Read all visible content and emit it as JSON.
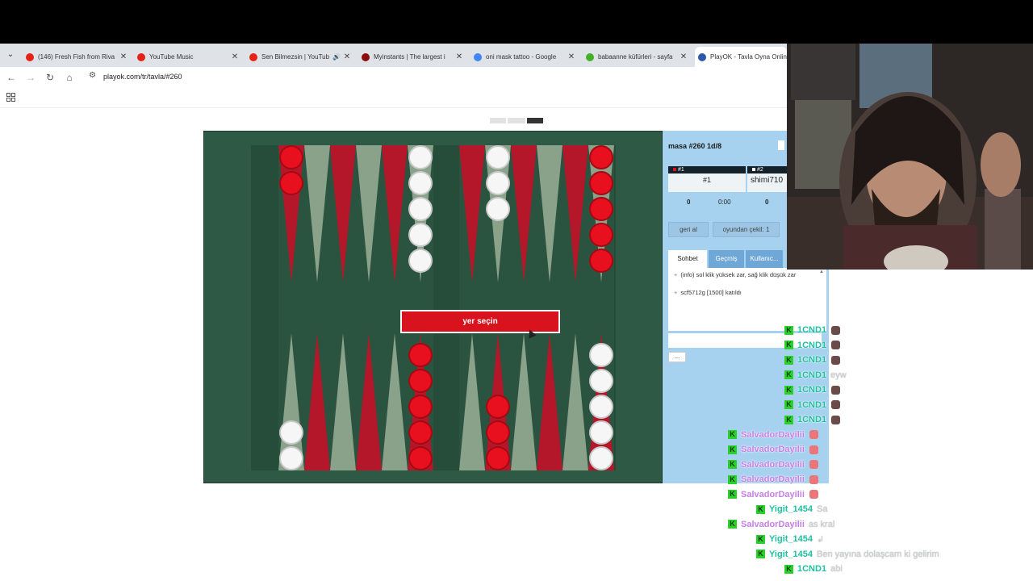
{
  "browser": {
    "tabs": [
      {
        "title": "(146) Fresh Fish from Riva",
        "icon": "youtube-icon",
        "color": "#e62117",
        "active": false
      },
      {
        "title": "YouTube Music",
        "icon": "youtube-music-icon",
        "color": "#e62117",
        "active": false
      },
      {
        "title": "Sen Bilmezsin | YouTub",
        "icon": "youtube-music-icon",
        "color": "#e62117",
        "active": false,
        "audio": "🔊"
      },
      {
        "title": "Myinstants | The largest i",
        "icon": "myinstants-icon",
        "color": "#8a0e0e",
        "active": false
      },
      {
        "title": "oni mask tattoo - Google",
        "icon": "google-icon",
        "color": "#4285f4",
        "active": false
      },
      {
        "title": "babaanne küfürleri - sayfa",
        "icon": "leaf-icon",
        "color": "#44b02a",
        "active": false
      },
      {
        "title": "PlayOK - Tavla Oyna Onlin",
        "icon": "star-icon",
        "color": "#2a5aa8",
        "active": true
      }
    ],
    "tab_close": "✕",
    "tab_dropdown": "⌄",
    "nav": {
      "back": "←",
      "forward": "→",
      "reload": "↻",
      "home": "⌂",
      "site_info": "⚙"
    },
    "url": "playok.com/tr/tavla/#260"
  },
  "game": {
    "status_banner": "yer seçin",
    "board_colors": {
      "dark_point": "#b5172a",
      "light_point": "#8aa18a",
      "felt": "#2a5340",
      "bar": "#264c3a"
    },
    "checkers": {
      "top": [
        {
          "point": 12,
          "color": "red",
          "count": 2
        },
        {
          "point": 7,
          "color": "white",
          "count": 5
        },
        {
          "point": 5,
          "color": "white",
          "count": 3
        },
        {
          "point": 1,
          "color": "red",
          "count": 5
        }
      ],
      "bottom": [
        {
          "point": 13,
          "color": "white",
          "count": 2
        },
        {
          "point": 18,
          "color": "red",
          "count": 5
        },
        {
          "point": 20,
          "color": "red",
          "count": 3
        },
        {
          "point": 24,
          "color": "white",
          "count": 5
        }
      ]
    }
  },
  "side": {
    "table_title": "masa #260  1d/8",
    "players": [
      {
        "header": "#1",
        "name": "#1",
        "score": "0",
        "clock": "0:00"
      },
      {
        "header": "#2",
        "name": "shimi710",
        "score": "0"
      }
    ],
    "buttons": {
      "undo": "geri al",
      "resign": "oyundan çekil: 1"
    },
    "chat_tabs": [
      "Sohbet",
      "Geçmiş",
      "Kullanıc..."
    ],
    "chat_lines": [
      {
        "text": "(info) sol klik yüksek zar, sağ klik düşük zar"
      },
      {
        "text": "scf5712g [1500] katıldı"
      }
    ],
    "more_label": "..."
  },
  "overlay_chat": [
    {
      "user": "1CND1",
      "user_color": "#1fbf9f",
      "msg": "",
      "emote": "hat"
    },
    {
      "user": "1CND1",
      "user_color": "#1fbf9f",
      "msg": "",
      "emote": "hat"
    },
    {
      "user": "1CND1",
      "user_color": "#1fbf9f",
      "msg": "",
      "emote": "hat"
    },
    {
      "user": "1CND1",
      "user_color": "#1fbf9f",
      "msg": "eyw",
      "emote": ""
    },
    {
      "user": "1CND1",
      "user_color": "#1fbf9f",
      "msg": "",
      "emote": "hat"
    },
    {
      "user": "1CND1",
      "user_color": "#1fbf9f",
      "msg": "",
      "emote": "hat"
    },
    {
      "user": "1CND1",
      "user_color": "#1fbf9f",
      "msg": "",
      "emote": "hat"
    },
    {
      "user": "SalvadorDayilii",
      "user_color": "#c77ee6",
      "msg": "",
      "emote": "brain"
    },
    {
      "user": "SalvadorDayilii",
      "user_color": "#c77ee6",
      "msg": "",
      "emote": "brain"
    },
    {
      "user": "SalvadorDayilii",
      "user_color": "#c77ee6",
      "msg": "",
      "emote": "brain"
    },
    {
      "user": "SalvadorDayilii",
      "user_color": "#c77ee6",
      "msg": "",
      "emote": "brain"
    },
    {
      "user": "SalvadorDayilii",
      "user_color": "#c77ee6",
      "msg": "",
      "emote": "brain"
    },
    {
      "user": "Yigit_1454",
      "user_color": "#1fbf9f",
      "msg": "Sa",
      "emote": ""
    },
    {
      "user": "SalvadorDayilii",
      "user_color": "#c77ee6",
      "msg": "as kral",
      "emote": ""
    },
    {
      "user": "Yigit_1454",
      "user_color": "#1fbf9f",
      "msg": "↲",
      "emote": ""
    },
    {
      "user": "Yigit_1454",
      "user_color": "#1fbf9f",
      "msg": "Ben yayına dolaşcam ki gelirim",
      "emote": ""
    },
    {
      "user": "1CND1",
      "user_color": "#1fbf9f",
      "msg": "abi",
      "emote": ""
    }
  ]
}
